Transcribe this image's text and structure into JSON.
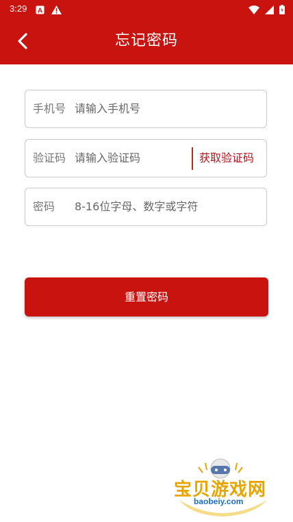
{
  "status_bar": {
    "time": "3:29",
    "icons_left": [
      "a-badge-icon",
      "warning-icon"
    ],
    "icons_right": [
      "wifi-icon",
      "signal-icon",
      "battery-icon"
    ]
  },
  "app_bar": {
    "title": "忘记密码",
    "back_icon": "chevron-left-icon",
    "color": "#c8130e"
  },
  "form": {
    "phone": {
      "label": "手机号",
      "placeholder": "请输入手机号"
    },
    "code": {
      "label": "验证码",
      "placeholder": "请输入验证码",
      "button": "获取验证码"
    },
    "password": {
      "label": "密码",
      "placeholder": "8-16位字母、数字或字符"
    },
    "submit": "重置密码"
  },
  "watermark": {
    "text": "宝贝游戏网",
    "url": "baobeiy.com"
  }
}
